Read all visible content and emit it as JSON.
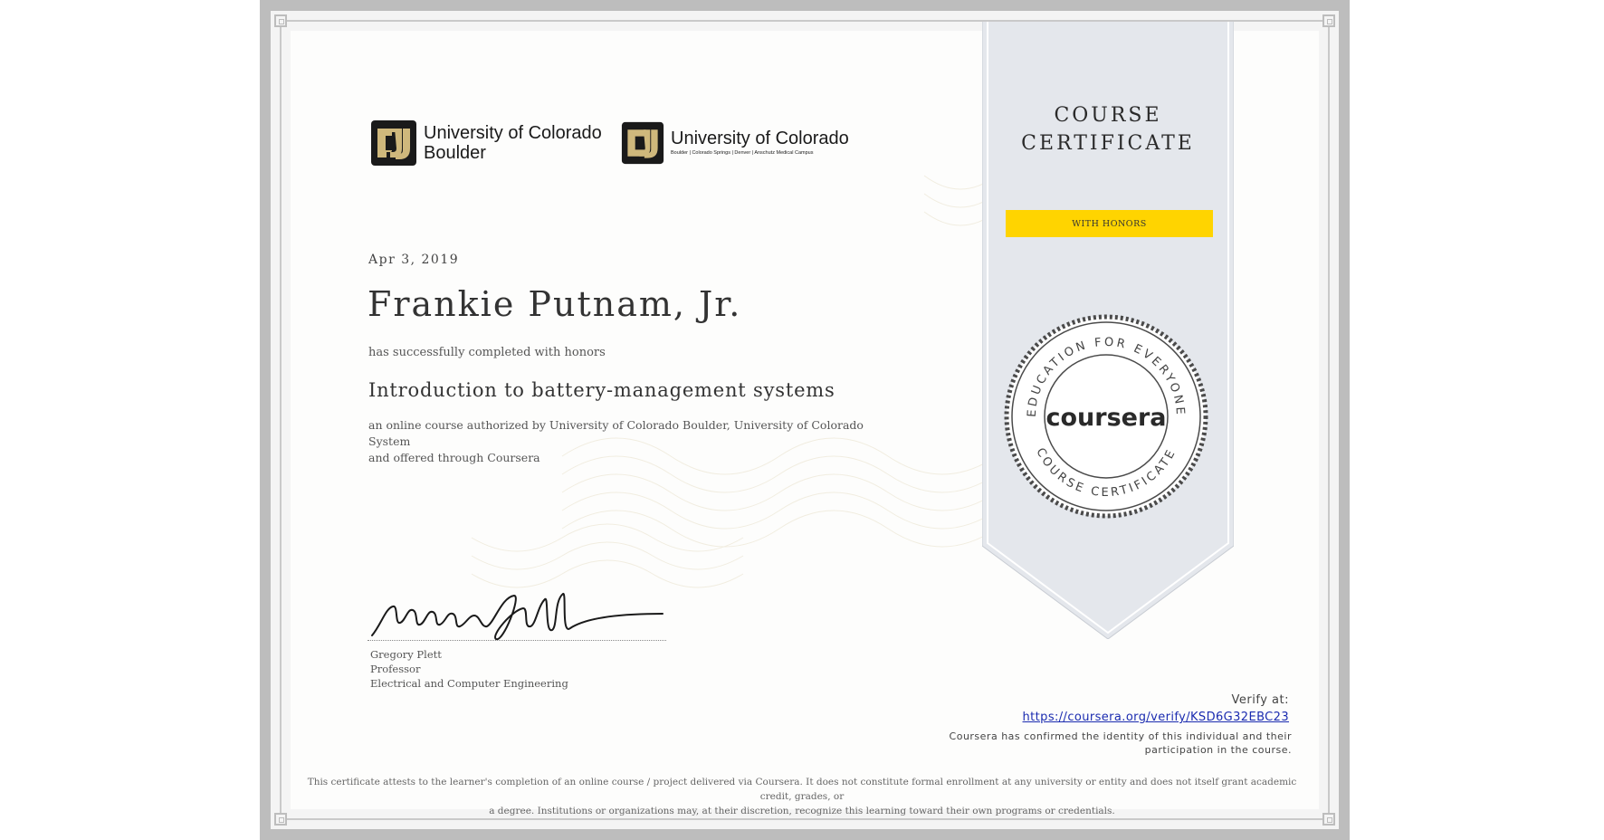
{
  "logos": {
    "boulder": {
      "line1": "University of Colorado",
      "line2": "Boulder"
    },
    "system": {
      "line1": "University of Colorado",
      "campuses": "Boulder | Colorado Springs | Denver | Anschutz Medical Campus"
    }
  },
  "certificate": {
    "date": "Apr 3, 2019",
    "learner_name": "Frankie Putnam, Jr.",
    "completion_line": "has successfully completed with honors",
    "course_title": "Introduction to battery-management systems",
    "description_line1": "an online course authorized by University of Colorado Boulder, University of Colorado System",
    "description_line2": "and offered through Coursera"
  },
  "signer": {
    "name": "Gregory Plett",
    "title": "Professor",
    "department": "Electrical and Computer Engineering"
  },
  "ribbon": {
    "heading_line1": "COURSE",
    "heading_line2": "CERTIFICATE",
    "honors_badge": "WITH HONORS",
    "seal_wordmark": "coursera",
    "seal_top_text": "EDUCATION FOR EVERYONE",
    "seal_bottom_text": "COURSE CERTIFICATE"
  },
  "verify": {
    "label": "Verify at:",
    "url": "https://coursera.org/verify/KSD6G32EBC23",
    "note_line1": "Coursera has confirmed the identity of this individual and their",
    "note_line2": "participation in the course."
  },
  "disclaimer": {
    "line1": "This certificate attests to the learner's completion of an online course / project delivered via Coursera. It does not constitute formal enrollment at any university or entity and does not itself grant academic credit, grades, or",
    "line2": "a degree. Institutions or organizations may, at their discretion, recognize this learning toward their own programs or credentials."
  },
  "colors": {
    "frame": "#bdbdbd",
    "ribbon": "#e4e7ec",
    "honors": "#ffd400",
    "cu_gold": "#cfb87c",
    "link": "#1a2bb0"
  }
}
